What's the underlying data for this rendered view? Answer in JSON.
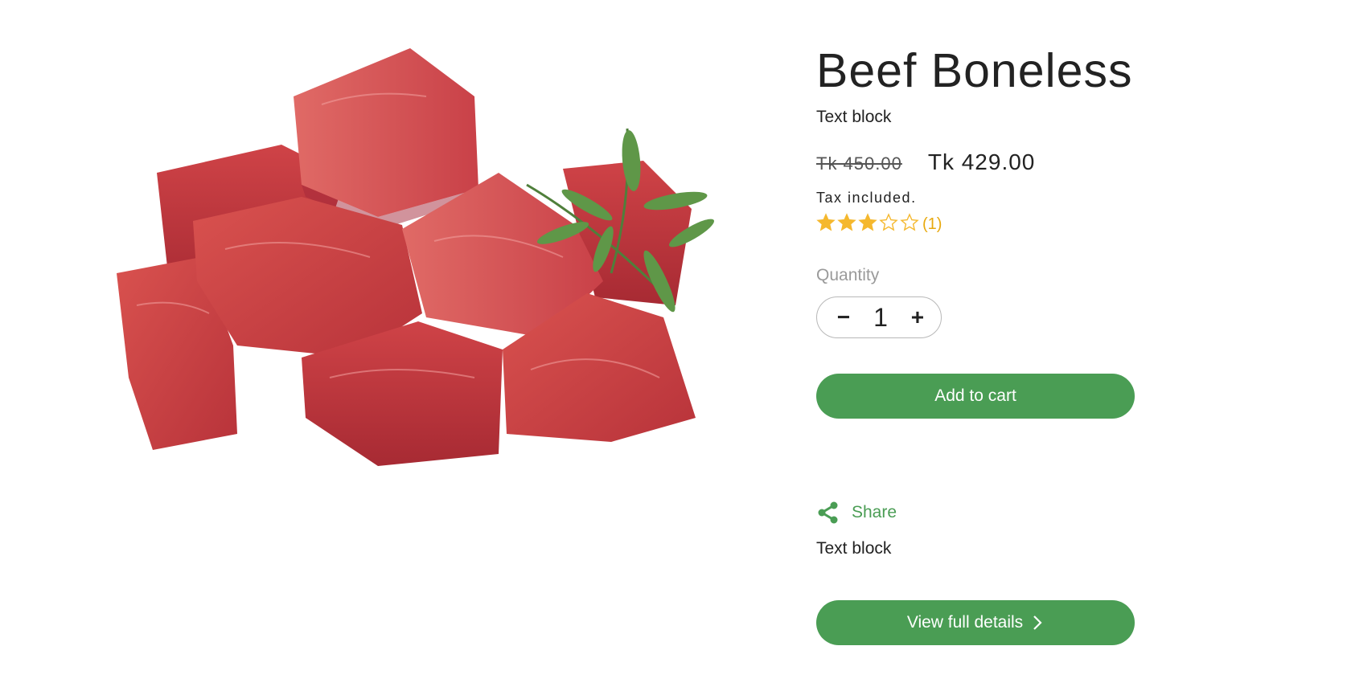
{
  "product": {
    "title": "Beef Boneless",
    "text_block": "Text block",
    "price_regular": "Tk 450.00",
    "price_sale": "Tk 429.00",
    "tax_note": "Tax included.",
    "rating": {
      "value": 3,
      "max": 5,
      "count_label": "(1)"
    },
    "image_icon": "beef-cubes-with-rosemary-image"
  },
  "quantity": {
    "label": "Quantity",
    "value": "1",
    "minus_label": "−",
    "plus_label": "+"
  },
  "actions": {
    "add_to_cart": "Add to cart",
    "share": "Share",
    "text_block_2": "Text block",
    "view_full_details": "View full details"
  },
  "colors": {
    "accent": "#4a9d54",
    "star": "#f5b82e",
    "text": "#222222",
    "muted": "#9a9a9a"
  }
}
